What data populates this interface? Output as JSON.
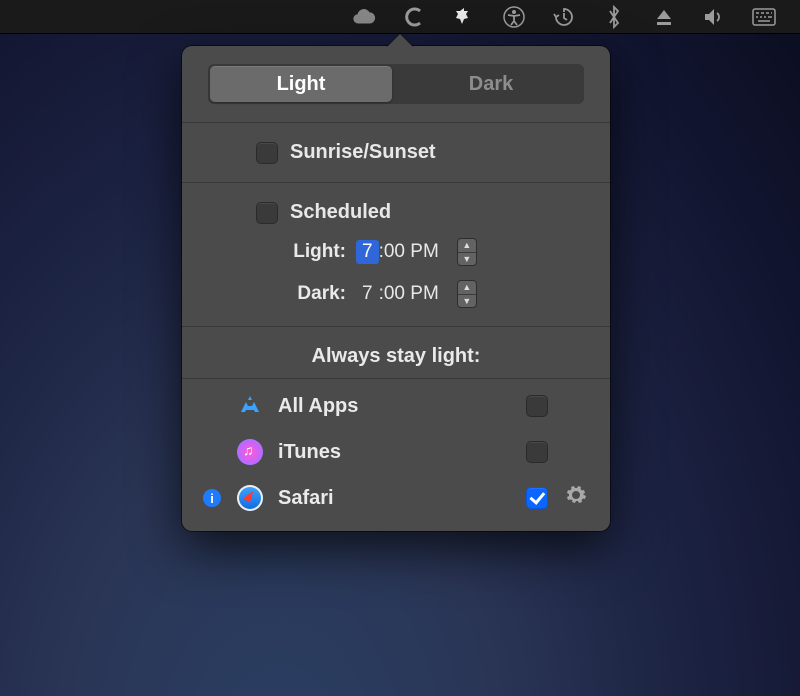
{
  "menubar": {
    "icons": [
      "creative-cloud",
      "c-icon",
      "nightowl-icon",
      "accessibility-icon",
      "time-machine-icon",
      "bluetooth-icon",
      "eject-icon",
      "volume-icon",
      "keyboard-icon"
    ]
  },
  "segmented": {
    "light_label": "Light",
    "dark_label": "Dark",
    "selected": "light"
  },
  "options": {
    "sunrise_label": "Sunrise/Sunset",
    "sunrise_checked": false,
    "scheduled_label": "Scheduled",
    "scheduled_checked": false,
    "light_label": "Light:",
    "light_time_hour": "7",
    "light_time_rest": ":00 PM",
    "light_hour_selected": true,
    "dark_label": "Dark:",
    "dark_time_hour": "7",
    "dark_time_rest": ":00 PM",
    "dark_hour_selected": false
  },
  "always": {
    "header": "Always stay light:",
    "apps": [
      {
        "name": "All Apps",
        "icon": "appstore",
        "checked": false,
        "info": false,
        "gear": false
      },
      {
        "name": "iTunes",
        "icon": "itunes",
        "checked": false,
        "info": false,
        "gear": false
      },
      {
        "name": "Safari",
        "icon": "safari",
        "checked": true,
        "info": true,
        "gear": true
      }
    ]
  }
}
